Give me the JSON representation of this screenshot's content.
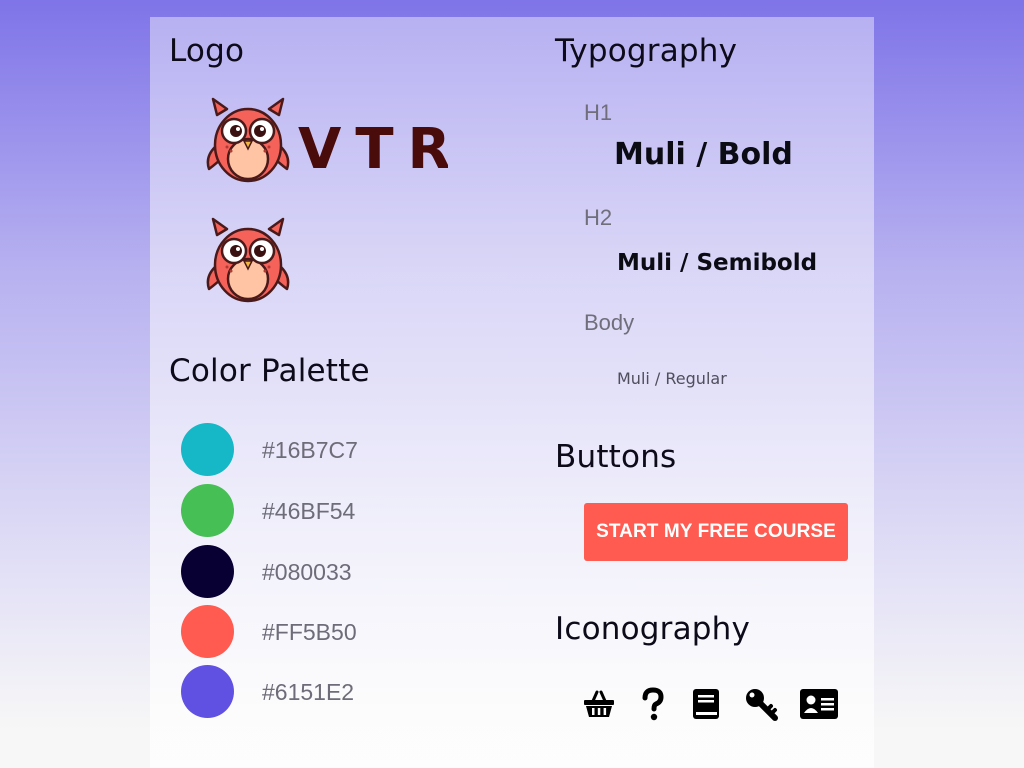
{
  "logo": {
    "heading": "Logo",
    "wordmark": "VTR",
    "colors": {
      "owl_body": "#f4625a",
      "owl_belly": "#ffc4a3",
      "owl_outline": "#4a1a1a",
      "wordmark": "#4a0b0b"
    }
  },
  "palette": {
    "heading": "Color Palette",
    "colors": [
      {
        "hex": "#16B7C7",
        "label": "#16B7C7"
      },
      {
        "hex": "#46BF54",
        "label": "#46BF54"
      },
      {
        "hex": "#080033",
        "label": "#080033"
      },
      {
        "hex": "#FF5B50",
        "label": "#FF5B50"
      },
      {
        "hex": "#6151E2",
        "label": "#6151E2"
      }
    ]
  },
  "typography": {
    "heading": "Typography",
    "h1_label": "H1",
    "h1_sample": "Muli / Bold",
    "h2_label": "H2",
    "h2_sample": "Muli / Semibold",
    "body_label": "Body",
    "body_sample": "Muli / Regular"
  },
  "buttons": {
    "heading": "Buttons",
    "cta_label": "START MY FREE COURSE",
    "cta_color": "#FF5B50"
  },
  "iconography": {
    "heading": "Iconography",
    "icons": [
      "basket-icon",
      "question-icon",
      "book-icon",
      "key-icon",
      "id-card-icon"
    ]
  }
}
